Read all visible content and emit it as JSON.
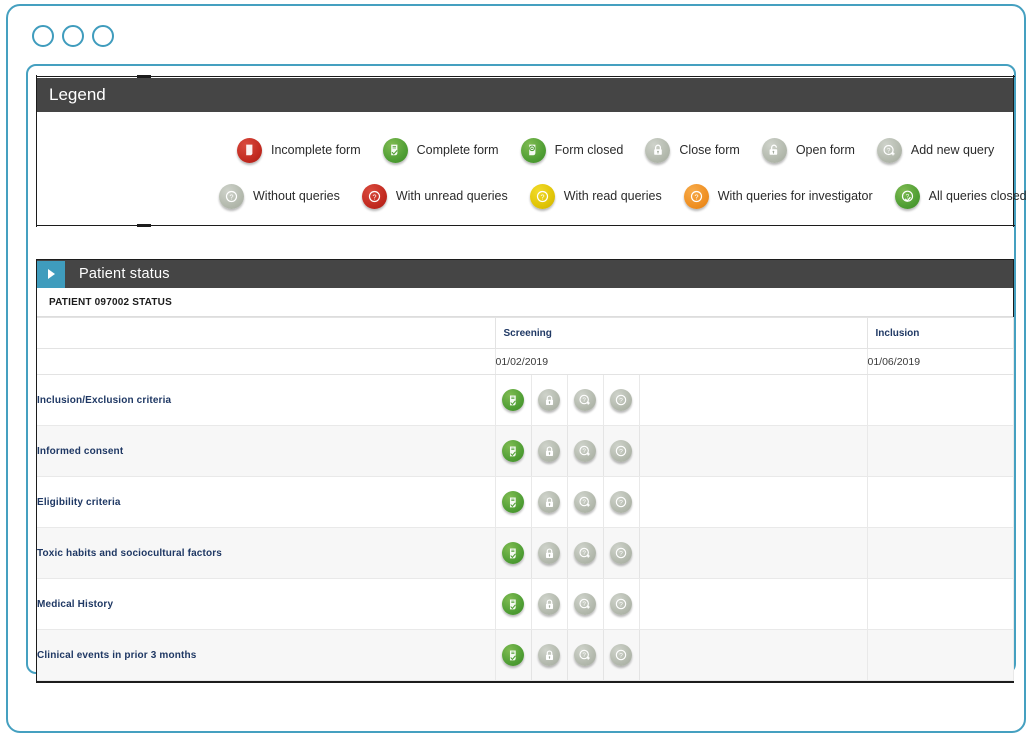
{
  "window": {
    "dots": [
      "circle-1",
      "circle-2",
      "circle-3"
    ]
  },
  "legend": {
    "title": "Legend",
    "rows": [
      [
        {
          "icon": "incomplete-form-icon",
          "color": "#c22a20",
          "label": "Incomplete form"
        },
        {
          "icon": "complete-form-icon",
          "color": "#4f9e34",
          "label": "Complete form"
        },
        {
          "icon": "form-closed-icon",
          "color": "#4f9e34",
          "label": "Form closed"
        },
        {
          "icon": "close-form-icon",
          "color": "#b3b9ad",
          "label": "Close form"
        },
        {
          "icon": "open-form-icon",
          "color": "#b3b9ad",
          "label": "Open form"
        },
        {
          "icon": "add-new-query-icon",
          "color": "#b3b9ad",
          "label": "Add new query"
        }
      ],
      [
        {
          "icon": "without-queries-icon",
          "color": "#b3b9ad",
          "label": "Without queries"
        },
        {
          "icon": "with-unread-queries-icon",
          "color": "#c22a20",
          "label": "With unread queries"
        },
        {
          "icon": "with-read-queries-icon",
          "color": "#e0c406",
          "label": "With read queries"
        },
        {
          "icon": "with-queries-for-investigator-icon",
          "color": "#ef8f22",
          "label": "With queries for investigator"
        },
        {
          "icon": "all-queries-closed-icon",
          "color": "#4f9e34",
          "label": "All queries closed"
        }
      ]
    ]
  },
  "patient_status": {
    "title": "Patient status",
    "subtitle": "PATIENT 097002 STATUS",
    "columns": [
      "",
      "Screening",
      "Inclusion"
    ],
    "dates": {
      "label": "",
      "screening": "01/02/2019",
      "inclusion": "01/06/2019"
    },
    "rows": [
      {
        "name": "Inclusion/Exclusion criteria",
        "screening_icons": [
          "complete-form-icon",
          "close-form-icon",
          "add-new-query-icon",
          "without-queries-icon"
        ],
        "inclusion_icons": []
      },
      {
        "name": "Informed consent",
        "screening_icons": [
          "complete-form-icon",
          "close-form-icon",
          "add-new-query-icon",
          "without-queries-icon"
        ],
        "inclusion_icons": []
      },
      {
        "name": "Eligibility criteria",
        "screening_icons": [
          "complete-form-icon",
          "close-form-icon",
          "add-new-query-icon",
          "without-queries-icon"
        ],
        "inclusion_icons": []
      },
      {
        "name": "Toxic habits and sociocultural factors",
        "screening_icons": [
          "complete-form-icon",
          "close-form-icon",
          "add-new-query-icon",
          "without-queries-icon"
        ],
        "inclusion_icons": []
      },
      {
        "name": "Medical History",
        "screening_icons": [
          "complete-form-icon",
          "close-form-icon",
          "add-new-query-icon",
          "without-queries-icon"
        ],
        "inclusion_icons": []
      },
      {
        "name": "Clinical events in prior 3 months",
        "screening_icons": [
          "complete-form-icon",
          "close-form-icon",
          "add-new-query-icon",
          "without-queries-icon"
        ],
        "inclusion_icons": []
      }
    ]
  },
  "theme": {
    "accent": "#3f9cbd",
    "header_bar": "#454545",
    "label_blue": "#1f3864"
  }
}
